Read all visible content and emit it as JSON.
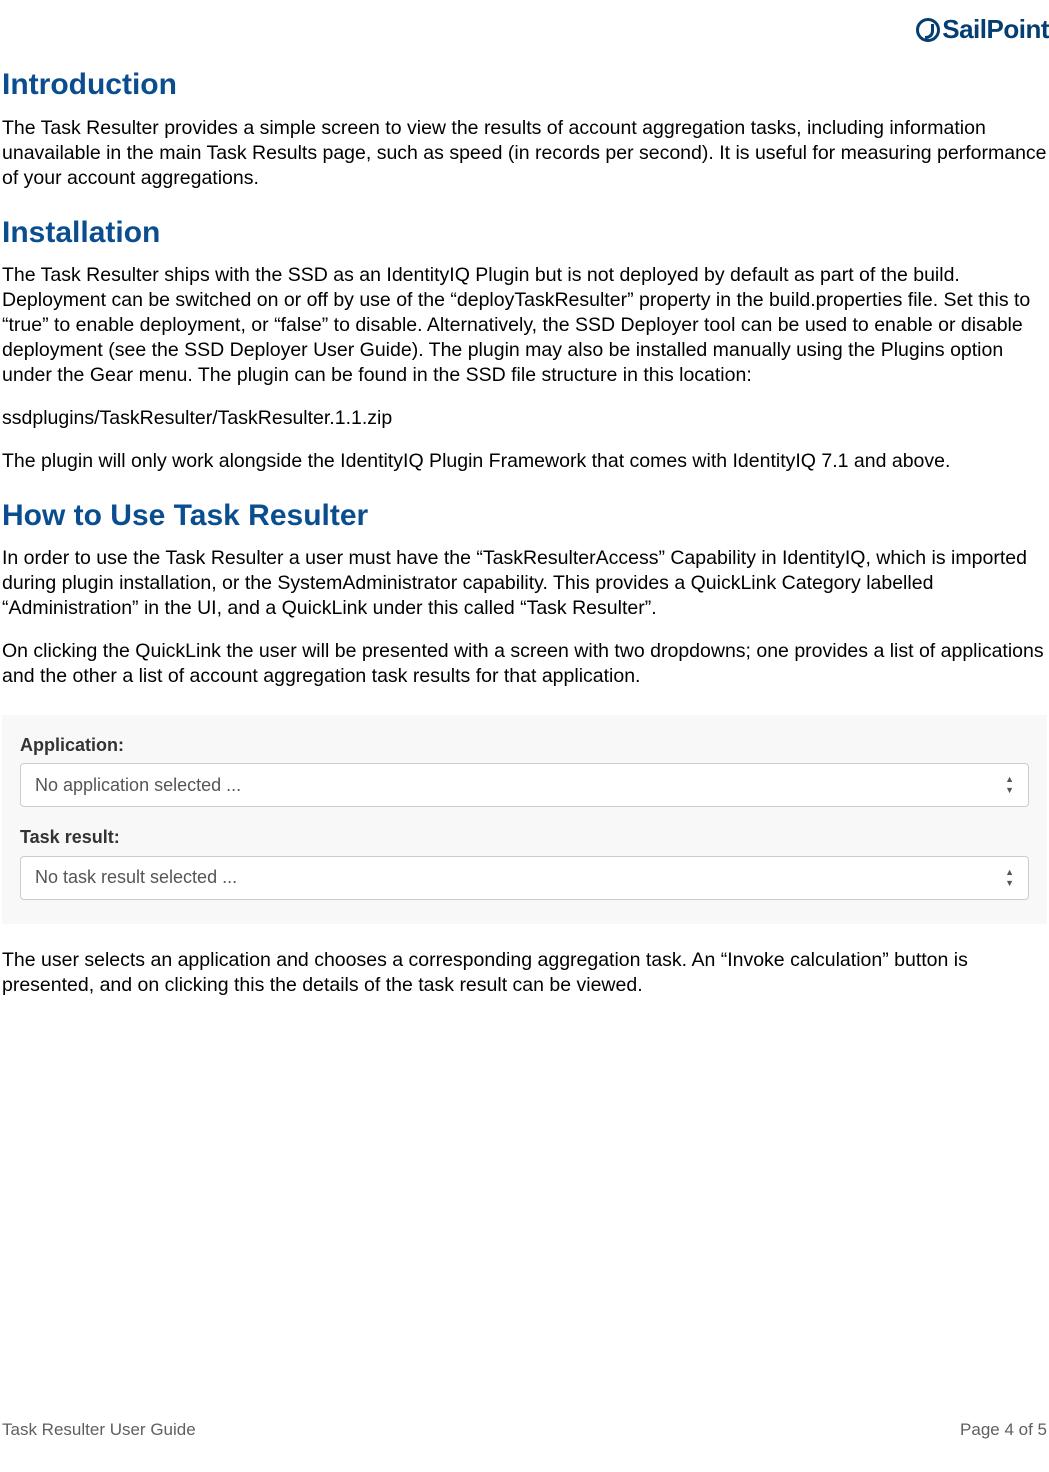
{
  "logo": {
    "text": "SailPoint"
  },
  "sections": {
    "introduction": {
      "heading": "Introduction",
      "p1": "The Task Resulter provides a simple screen to view the results of account aggregation tasks, including information unavailable in the main Task Results page, such as speed (in records per second).  It is useful for measuring performance of your account aggregations."
    },
    "installation": {
      "heading": "Installation",
      "p1": "The Task Resulter ships with the SSD as an IdentityIQ Plugin but is not deployed by default as part of the build.  Deployment can be switched on or off by use of the “deployTaskResulter” property in the build.properties file.  Set this to “true” to enable deployment, or “false” to disable.  Alternatively, the SSD Deployer tool can be used to enable or disable deployment (see the SSD Deployer User Guide).  The plugin may also be installed manually using the Plugins option under the Gear menu.  The plugin can be found in the SSD file structure in this location:",
      "p2": "ssdplugins/TaskResulter/TaskResulter.1.1.zip",
      "p3": "The plugin will only work alongside the IdentityIQ Plugin Framework that comes with IdentityIQ 7.1 and above."
    },
    "howto": {
      "heading": "How to Use Task Resulter",
      "p1": "In order to use the Task Resulter a user must have the “TaskResulterAccess” Capability in IdentityIQ, which is imported during plugin installation, or the SystemAdministrator capability.  This provides a QuickLink Category labelled “Administration” in the UI, and a QuickLink under this called “Task Resulter”.",
      "p2": "On clicking the QuickLink the user will be presented with a screen with two dropdowns; one provides a list of applications and the other a list of account aggregation task results for that application.",
      "p3": "The user selects an application and chooses a corresponding aggregation task.  An “Invoke calculation” button is presented, and on clicking this the details of the task result can be viewed."
    }
  },
  "ui_panel": {
    "application": {
      "label": "Application:",
      "value": "No application selected ..."
    },
    "task_result": {
      "label": "Task result:",
      "value": "No task result selected ..."
    }
  },
  "footer": {
    "left": "Task Resulter User Guide",
    "right": "Page 4 of 5"
  }
}
